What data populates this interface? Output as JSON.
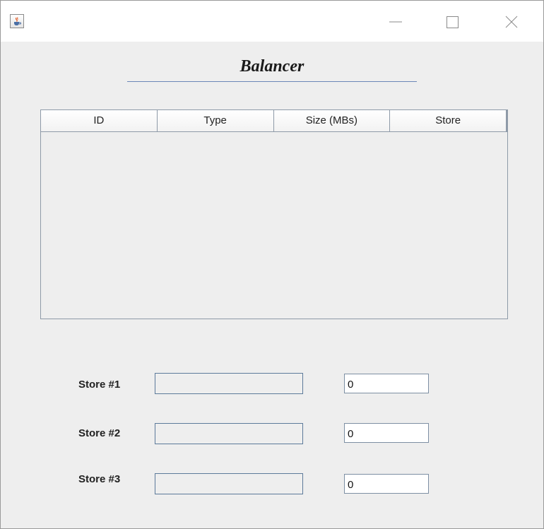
{
  "window": {
    "title": "Balancer",
    "icon": "java-cup-icon",
    "controls": {
      "minimize": "minimize-icon",
      "maximize": "maximize-icon",
      "close": "close-icon"
    }
  },
  "table": {
    "columns": [
      "ID",
      "Type",
      "Size (MBs)",
      "Store"
    ],
    "rows": []
  },
  "stores": [
    {
      "label": "Store #1",
      "progress": 0,
      "count": "0"
    },
    {
      "label": "Store #2",
      "progress": 0,
      "count": "0"
    },
    {
      "label": "Store #3",
      "progress": 0,
      "count": "0"
    }
  ],
  "colors": {
    "window_bg": "#eeeeee",
    "title_underline": "#6b87b8",
    "border": "#8e9aa8"
  }
}
